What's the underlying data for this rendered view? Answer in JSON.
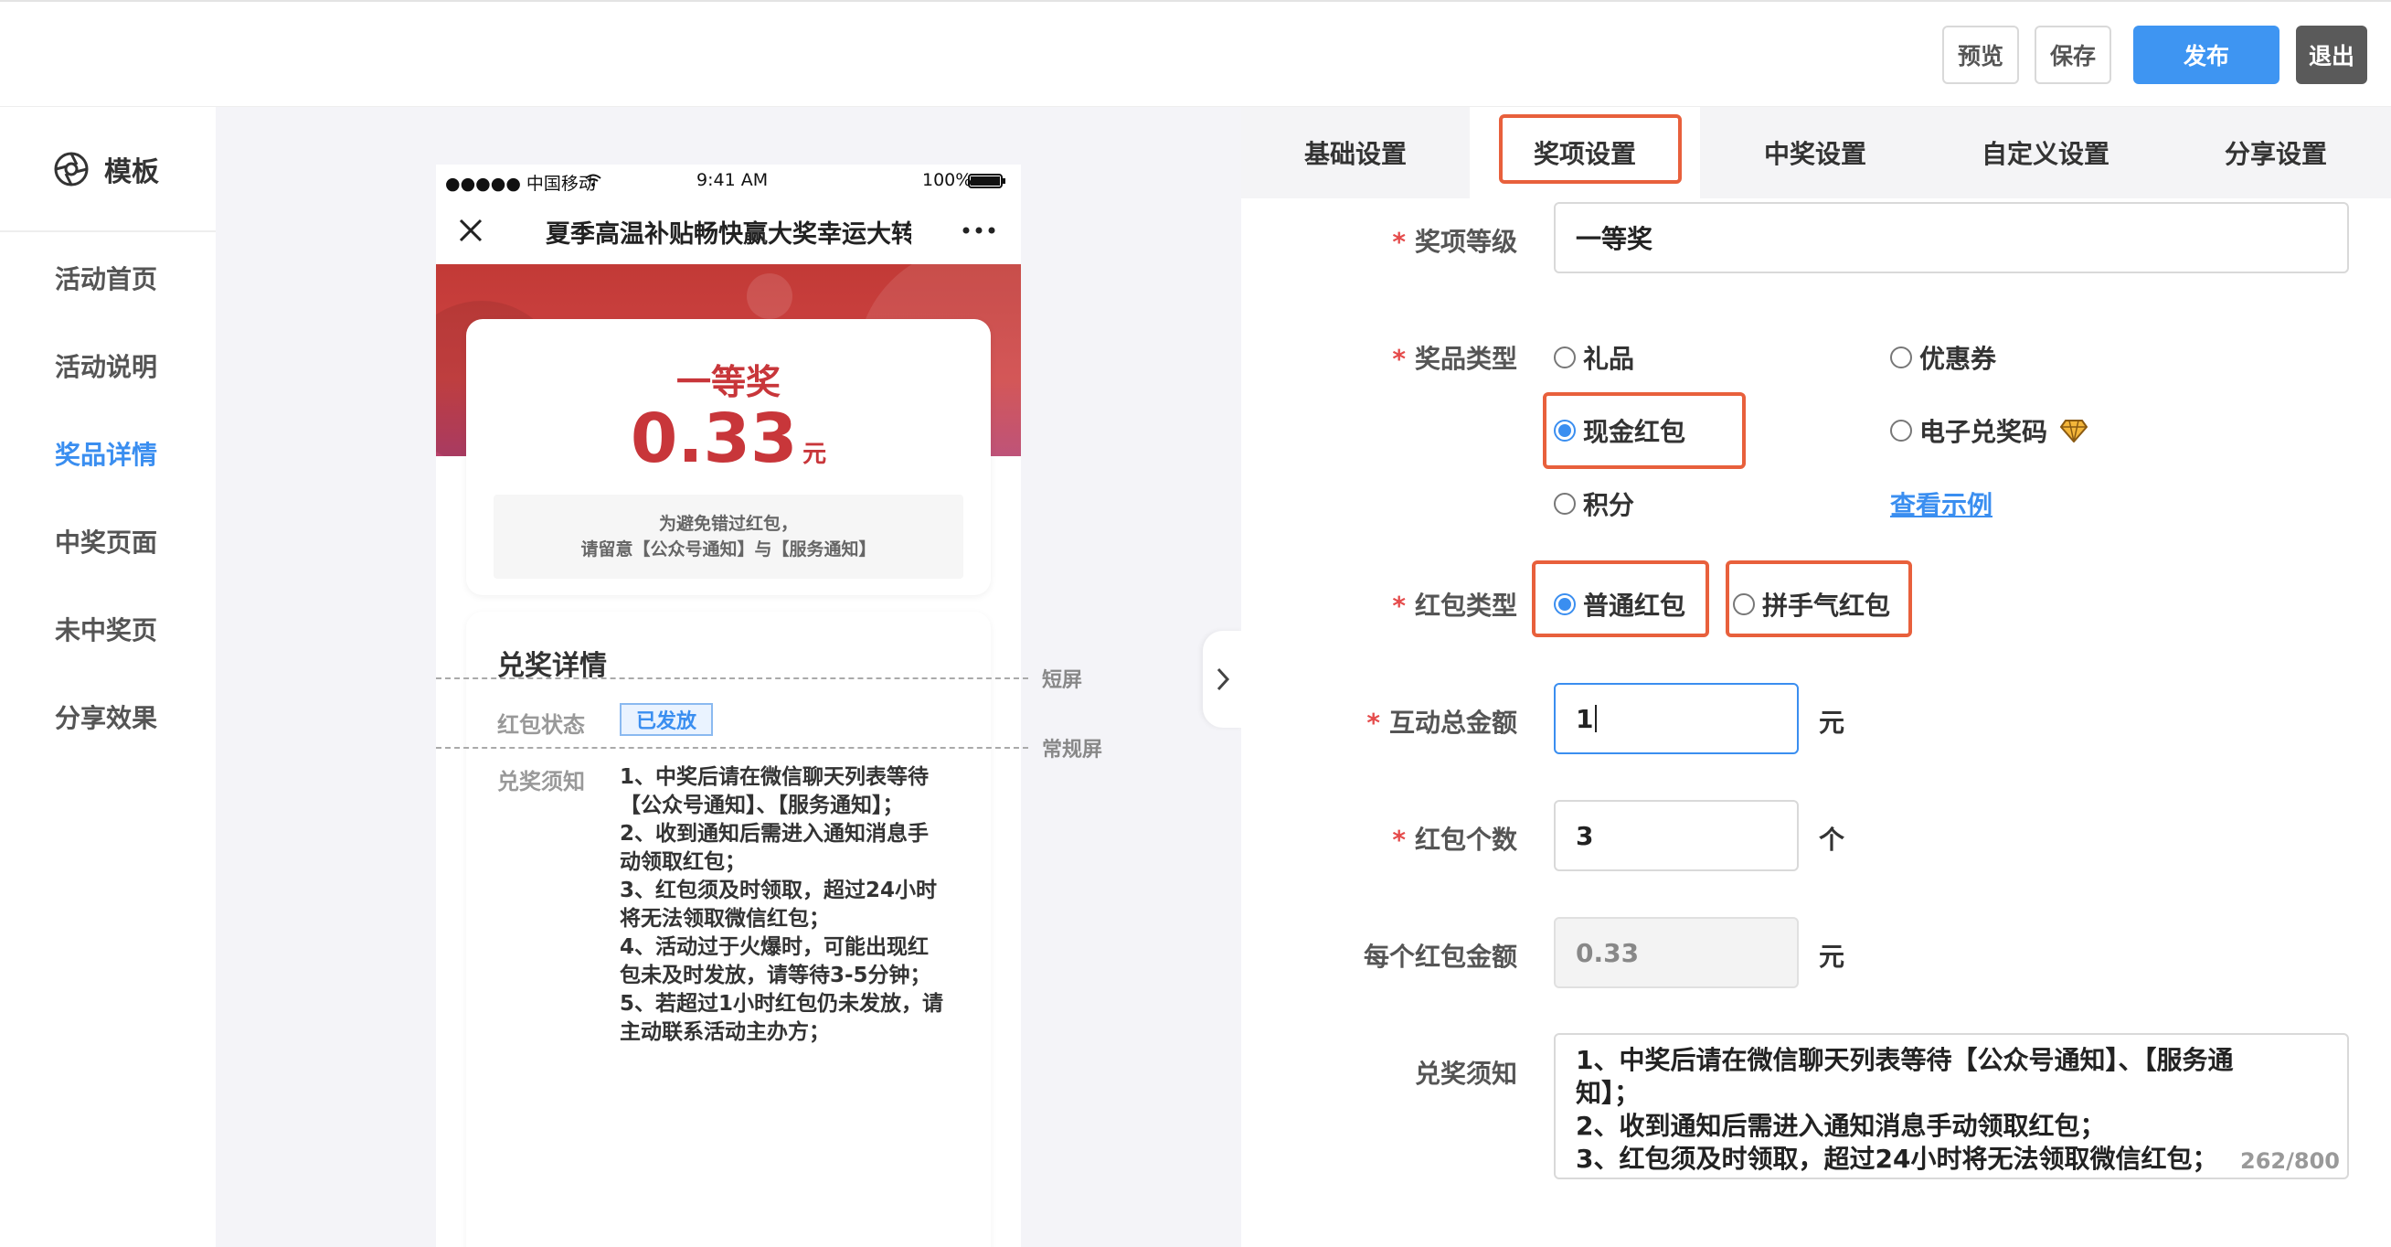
{
  "toolbar": {
    "preview": "预览",
    "save": "保存",
    "publish": "发布",
    "exit": "退出",
    "publish_color": "#3e95f2",
    "exit_color": "#5a5a5a"
  },
  "sidebar": {
    "brand": "模板",
    "items": [
      {
        "label": "活动首页",
        "active": false
      },
      {
        "label": "活动说明",
        "active": false
      },
      {
        "label": "奖品详情",
        "active": true
      },
      {
        "label": "中奖页面",
        "active": false
      },
      {
        "label": "未中奖页",
        "active": false
      },
      {
        "label": "分享效果",
        "active": false
      }
    ],
    "accent": "#3a8ef0"
  },
  "phone": {
    "carrier": "●●●●● 中国移动",
    "time": "9:41 AM",
    "battery": "100%",
    "title": "夏季高温补贴畅快赢大奖幸运大转",
    "prize_level": "一等奖",
    "amount": "0.33",
    "amount_unit": "元",
    "notice_line1": "为避免错过红包，",
    "notice_line2": "请留意【公众号通知】与【服务通知】",
    "detail_title": "兑奖详情",
    "status_label": "红包状态",
    "status_value": "已发放",
    "rules_label": "兑奖须知",
    "rules": [
      "1、中奖后请在微信聊天列表等待",
      "【公众号通知】、【服务通知】；",
      "2、收到通知后需进入通知消息手",
      "动领取红包；",
      "3、红包须及时领取，超过24小时",
      "将无法领取微信红包；",
      "4、活动过于火爆时，可能出现红",
      "包未及时发放，请等待3-5分钟；",
      "5、若超过1小时红包仍未发放，请",
      "主动联系活动主办方；"
    ],
    "short_screen": "短屏",
    "normal_screen": "常规屏",
    "prize_color": "#c8363a"
  },
  "tabs": [
    {
      "label": "基础设置",
      "active": false
    },
    {
      "label": "奖项设置",
      "active": true
    },
    {
      "label": "中奖设置",
      "active": false
    },
    {
      "label": "自定义设置",
      "active": false
    },
    {
      "label": "分享设置",
      "active": false
    }
  ],
  "form": {
    "level": {
      "label": "奖项等级",
      "value": "一等奖"
    },
    "prize_type": {
      "label": "奖品类型",
      "options": [
        {
          "label": "礼品",
          "checked": false
        },
        {
          "label": "优惠券",
          "checked": false
        },
        {
          "label": "现金红包",
          "checked": true
        },
        {
          "label": "电子兑奖码",
          "checked": false
        },
        {
          "label": "积分",
          "checked": false
        }
      ],
      "example_link": "查看示例"
    },
    "packet_type": {
      "label": "红包类型",
      "options": [
        {
          "label": "普通红包",
          "checked": true
        },
        {
          "label": "拼手气红包",
          "checked": false
        }
      ]
    },
    "total": {
      "label": "互动总金额",
      "value": "1",
      "unit": "元"
    },
    "count": {
      "label": "红包个数",
      "value": "3",
      "unit": "个"
    },
    "each": {
      "label": "每个红包金额",
      "value": "0.33",
      "unit": "元"
    },
    "rules": {
      "label": "兑奖须知",
      "lines": [
        "1、中奖后请在微信聊天列表等待【公众号通知】、【服务通",
        "知】；",
        "2、收到通知后需进入通知消息手动领取红包；",
        "3、红包须及时领取，超过24小时将无法领取微信红包；"
      ],
      "counter": "262/800"
    }
  },
  "highlight_color": "#e8603c"
}
